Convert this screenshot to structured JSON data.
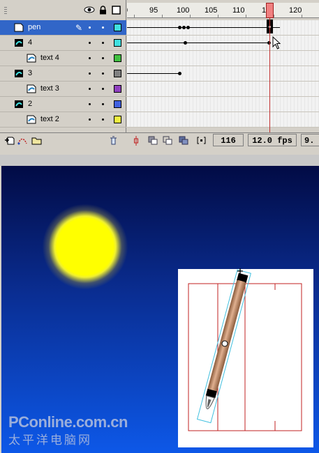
{
  "timeline": {
    "ruler_labels": [
      "0",
      "95",
      "100",
      "105",
      "110",
      "115",
      "120"
    ],
    "layers": [
      {
        "name": "pen",
        "type": "layer",
        "selected": true,
        "color": "#40e0e0"
      },
      {
        "name": "4",
        "type": "layer",
        "selected": false,
        "color": "#40e0e0"
      },
      {
        "name": "text 4",
        "type": "guided",
        "selected": false,
        "color": "#40c040"
      },
      {
        "name": "3",
        "type": "layer",
        "selected": false,
        "color": "#808080"
      },
      {
        "name": "text 3",
        "type": "guided",
        "selected": false,
        "color": "#9040c0"
      },
      {
        "name": "2",
        "type": "layer",
        "selected": false,
        "color": "#4060e0"
      },
      {
        "name": "text 2",
        "type": "guided",
        "selected": false,
        "color": "#f0f040"
      }
    ],
    "current_frame": "116",
    "fps": "12.0 fps",
    "elapsed": "9."
  },
  "icons": {
    "eye": "eye-icon",
    "lock": "lock-icon",
    "outline": "outline-icon",
    "insert_layer": "insert-layer-icon",
    "motion_guide": "add-motion-guide-icon",
    "insert_folder": "insert-folder-icon",
    "delete": "trash-icon"
  },
  "colors": {
    "selected_row": "#3166c8",
    "playhead": "#f08080",
    "sun": "#ffff00"
  },
  "watermark": {
    "line1": "PConline.com.cn",
    "line2": "太平洋电脑网"
  }
}
